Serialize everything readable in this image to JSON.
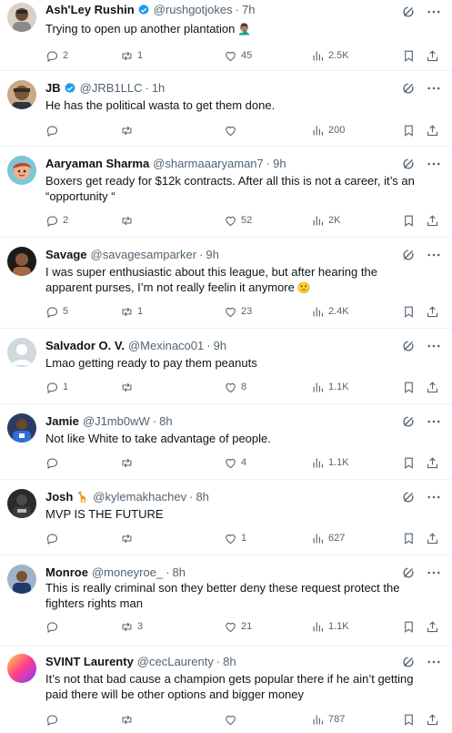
{
  "tweets": [
    {
      "name": "Ash'Ley Rushin",
      "verified": true,
      "handle": "@rushgotjokes",
      "time": "7h",
      "text": "Trying to open up another plantation",
      "emoji": "🤦🏽‍♂️",
      "replies": "2",
      "retweets": "1",
      "likes": "45",
      "views": "2.5K"
    },
    {
      "name": "JB",
      "verified": true,
      "handle": "@JRB1LLC",
      "time": "1h",
      "text": "He has the political wasta to get them done.",
      "replies": "",
      "retweets": "",
      "likes": "",
      "views": "200"
    },
    {
      "name": "Aaryaman Sharma",
      "verified": false,
      "handle": "@sharmaaaryaman7",
      "time": "9h",
      "text": "Boxers get ready for $12k contracts. After all this is not a career, it’s an “opportunity “",
      "replies": "2",
      "retweets": "",
      "likes": "52",
      "views": "2K"
    },
    {
      "name": "Savage",
      "verified": false,
      "handle": "@savagesamparker",
      "time": "9h",
      "text": "I was super enthusiastic about this league, but after hearing the apparent purses, I’m not really feelin it anymore",
      "emoji": "🙁",
      "replies": "5",
      "retweets": "1",
      "likes": "23",
      "views": "2.4K"
    },
    {
      "name": "Salvador O. V.",
      "verified": false,
      "handle": "@Mexinaco01",
      "time": "9h",
      "text": "Lmao getting ready to pay them peanuts",
      "replies": "1",
      "retweets": "",
      "likes": "8",
      "views": "1.1K"
    },
    {
      "name": "Jamie",
      "verified": false,
      "handle": "@J1mb0wW",
      "time": "8h",
      "text": "Not like White to take advantage of people.",
      "replies": "",
      "retweets": "",
      "likes": "4",
      "views": "1.1K"
    },
    {
      "name": "Josh",
      "name_emoji": "🦒",
      "verified": false,
      "handle": "@kylemakhachev",
      "time": "8h",
      "text": "MVP IS THE FUTURE",
      "replies": "",
      "retweets": "",
      "likes": "1",
      "views": "627"
    },
    {
      "name": "Monroe",
      "verified": false,
      "handle": "@moneyroe_",
      "time": "8h",
      "text": "This is really criminal son they better deny these request protect the fighters rights man",
      "replies": "",
      "retweets": "3",
      "likes": "21",
      "views": "1.1K"
    },
    {
      "name": "SVINT Laurenty",
      "verified": false,
      "handle": "@cecLaurenty",
      "time": "8h",
      "text": "It’s not that bad cause a champion gets popular there if he ain’t getting paid there will be other options and bigger money",
      "replies": "",
      "retweets": "",
      "likes": "",
      "views": "787"
    }
  ],
  "colors": {
    "text": "#0f1419",
    "muted": "#536471",
    "verified": "#1d9bf0",
    "divider": "#eff3f4"
  },
  "icons": [
    "reply-icon",
    "retweet-icon",
    "like-icon",
    "views-icon",
    "bookmark-icon",
    "share-icon",
    "grok-icon",
    "more-icon",
    "verified-badge-icon"
  ]
}
